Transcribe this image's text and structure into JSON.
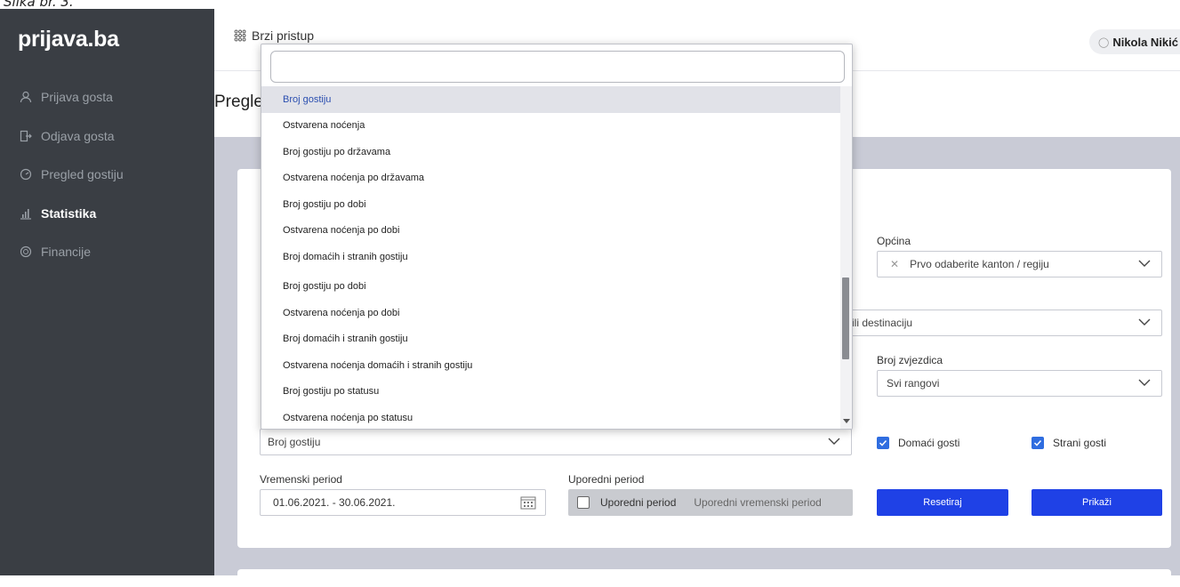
{
  "caption": "Slika br. 3.",
  "sidebar": {
    "logo": "prijava.ba",
    "items": [
      {
        "label": "Prijava gosta",
        "icon": "user-icon"
      },
      {
        "label": "Odjava gosta",
        "icon": "logout-icon"
      },
      {
        "label": "Pregled gostiju",
        "icon": "gauge-icon"
      },
      {
        "label": "Statistika",
        "icon": "chart-icon",
        "active": true
      },
      {
        "label": "Financije",
        "icon": "coins-icon"
      }
    ]
  },
  "topbar": {
    "quick_access": "Brzi pristup",
    "user_name": "Nikola Nikić"
  },
  "page": {
    "title": "Pregled"
  },
  "filters": {
    "opcina_label": "Općina",
    "opcina_placeholder": "Prvo odaberite kanton / regiju",
    "destinacija_text": "ili destinaciju",
    "zvjezdice_label": "Broj zvjezdica",
    "zvjezdice_value": "Svi rangovi",
    "report_value": "Broj gostiju",
    "domaci_label": "Domaći gosti",
    "strani_label": "Strani gosti",
    "vremenski_label": "Vremenski period",
    "vremenski_value": "01.06.2021. - 30.06.2021.",
    "uporedni_label": "Uporedni period",
    "uporedni_checkbox": "Uporedni period",
    "uporedni_placeholder": "Uporedni vremenski period",
    "reset_button": "Resetiraj",
    "show_button": "Prikaži"
  },
  "dropdown": {
    "search_value": "",
    "items_top": [
      "Broj gostiju",
      "Ostvarena noćenja",
      "Broj gostiju po državama",
      "Ostvarena noćenja po državama",
      "Broj gostiju po dobi",
      "Ostvarena noćenja po dobi",
      "Broj domaćih i stranih gostiju"
    ],
    "items_bottom": [
      "Broj gostiju po dobi",
      "Ostvarena noćenja po dobi",
      "Broj domaćih i stranih gostiju",
      "Ostvarena noćenja domaćih i stranih gostiju",
      "Broj gostiju po statusu",
      "Ostvarena noćenja po statusu"
    ]
  },
  "colors": {
    "sidebar_bg": "#3a3e44",
    "accent_blue": "#1f41e6",
    "checkbox_blue": "#2f6de0",
    "content_bg": "#c9cbd6"
  }
}
